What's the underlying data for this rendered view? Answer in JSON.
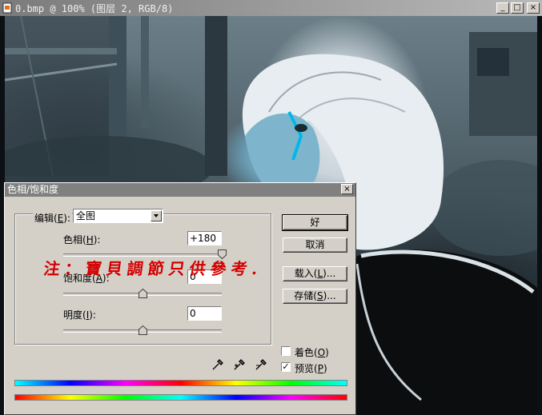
{
  "window": {
    "title": "0.bmp @ 100% (图层 2, RGB/8)",
    "minimize_glyph": "_",
    "maximize_glyph": "□",
    "close_glyph": "×",
    "icon": "document-icon"
  },
  "dialog": {
    "title": "色相/饱和度",
    "close_glyph": "×",
    "edit": {
      "label": "编辑",
      "mnemonic": "E",
      "value": "全图"
    },
    "hue": {
      "label": "色相",
      "mnemonic": "H",
      "value": "+180",
      "min": -180,
      "max": 180,
      "level": 180
    },
    "saturation": {
      "label": "饱和度",
      "mnemonic": "A",
      "value": "0",
      "min": -100,
      "max": 100,
      "level": 0
    },
    "lightness": {
      "label": "明度",
      "mnemonic": "I",
      "value": "0",
      "min": -100,
      "max": 100,
      "level": 0
    },
    "buttons": {
      "ok": "好",
      "cancel": "取消",
      "load": "载入",
      "load_mnemonic": "L",
      "save": "存储",
      "save_mnemonic": "S",
      "ellipsis": "..."
    },
    "colorize": {
      "label": "着色",
      "mnemonic": "O",
      "checked": false
    },
    "preview": {
      "label": "预览",
      "mnemonic": "P",
      "checked": true,
      "check_glyph": "✓"
    },
    "eyedroppers": [
      "eyedropper-icon",
      "eyedropper-plus-icon",
      "eyedropper-minus-icon"
    ]
  },
  "annotation": {
    "text": "注：寶貝調節只供參考."
  },
  "colors": {
    "dialog_bg": "#d4d0c8",
    "annotation_red": "#d40000",
    "title_gray": "#808080"
  }
}
